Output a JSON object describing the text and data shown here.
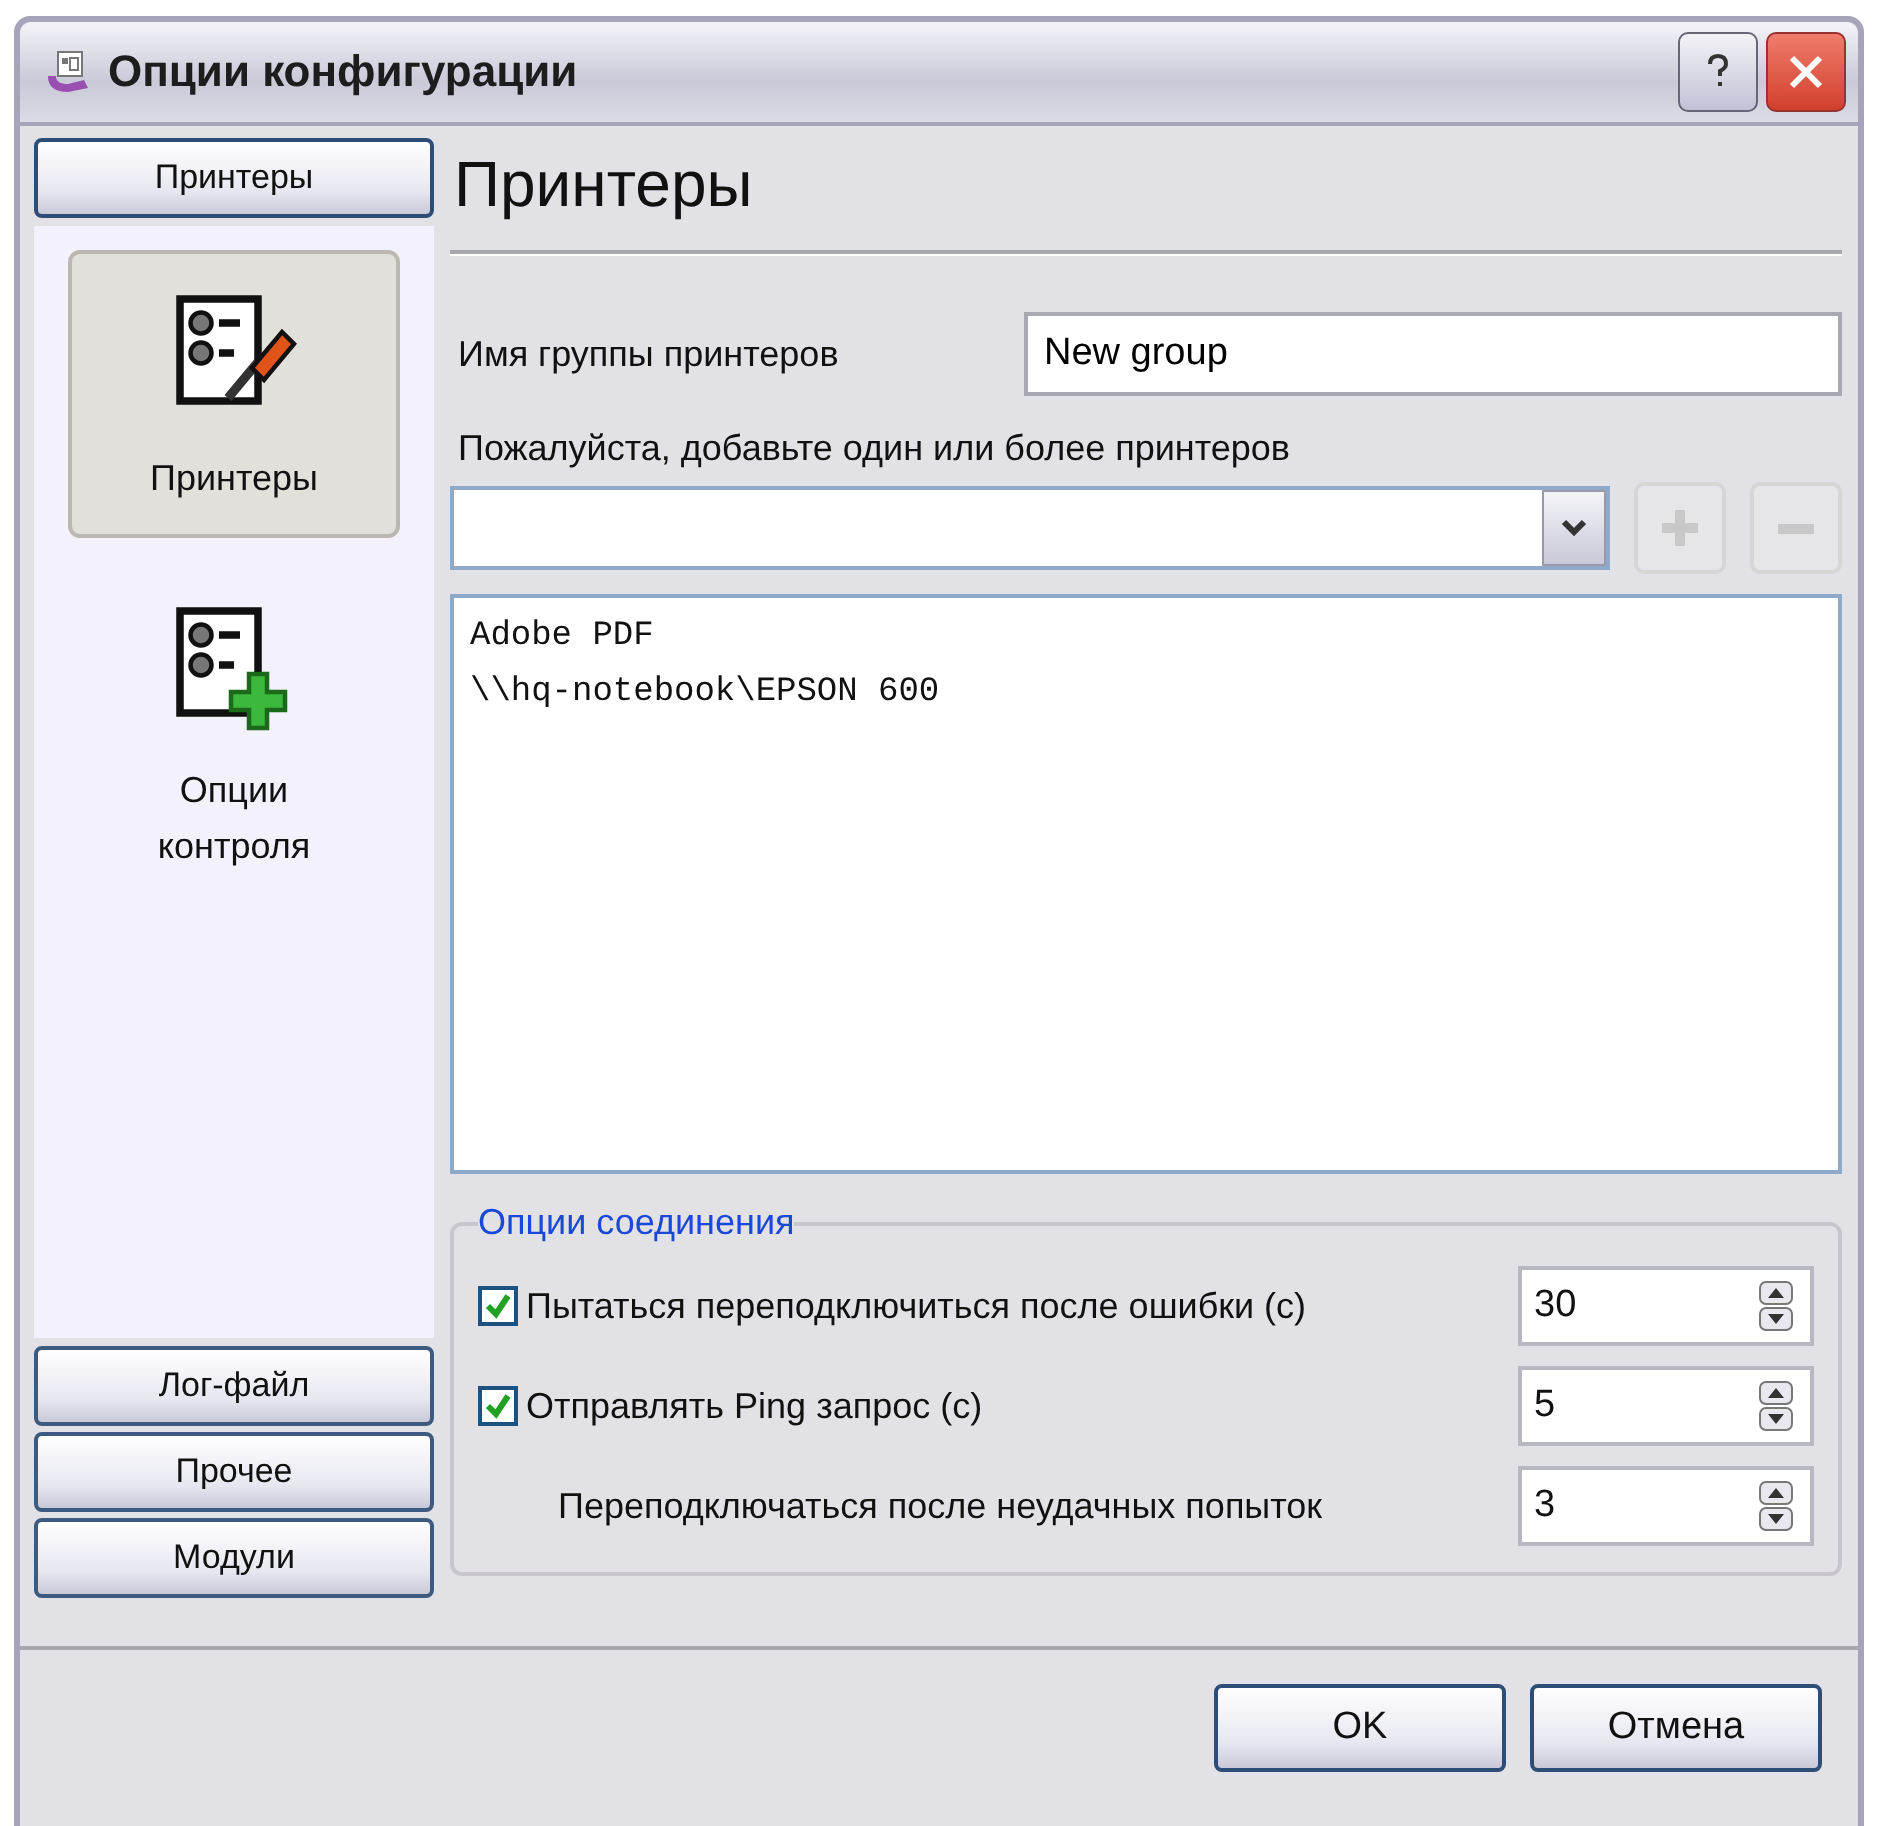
{
  "window": {
    "title": "Опции конфигурации"
  },
  "sidebar": {
    "groups": [
      {
        "label": "Принтеры",
        "expanded": true,
        "items": [
          {
            "label": "Принтеры",
            "kind": "settings",
            "selected": true
          },
          {
            "label": "Опции контроля",
            "kind": "add",
            "selected": false
          }
        ]
      },
      {
        "label": "Лог-файл",
        "expanded": false
      },
      {
        "label": "Прочее",
        "expanded": false
      },
      {
        "label": "Модули",
        "expanded": false
      }
    ]
  },
  "content": {
    "heading": "Принтеры",
    "group_name": {
      "label": "Имя группы принтеров",
      "value": "New group"
    },
    "printers_label": "Пожалуйста, добавьте один или более принтеров",
    "add_button": {
      "disabled": true
    },
    "remove_button": {
      "disabled": true
    },
    "printer_list": [
      "Adobe PDF",
      "\\\\hq-notebook\\EPSON 600"
    ],
    "connection_options": {
      "title": "Опции соединения",
      "rows": [
        {
          "kind": "checkbox",
          "label": "Пытаться переподключиться после ошибки (c)",
          "checked": true,
          "value": "30"
        },
        {
          "kind": "checkbox",
          "label": "Отправлять Ping запрос (c)",
          "checked": true,
          "value": "5"
        },
        {
          "kind": "plain",
          "label": "Переподключаться после неудачных попыток",
          "value": "3"
        }
      ]
    }
  },
  "buttons": [
    {
      "label": "OK"
    },
    {
      "label": "Отмена"
    }
  ]
}
